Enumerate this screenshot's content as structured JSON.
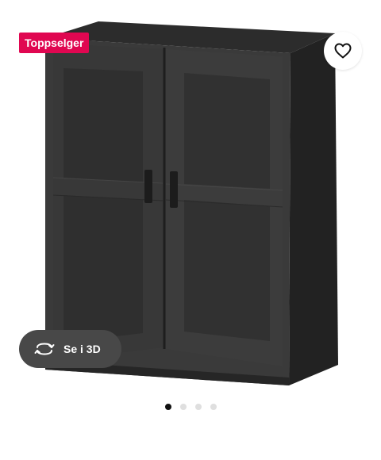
{
  "badge": {
    "label": "Toppselger"
  },
  "favorite": {
    "icon": "heart-outline-icon"
  },
  "view_3d": {
    "label": "Se i 3D",
    "icon": "rotate-3d-icon"
  },
  "carousel": {
    "total": 4,
    "active_index": 0
  },
  "colors": {
    "badge_bg": "#e00751",
    "pill_bg": "#484848",
    "cabinet": "#3a3a3a",
    "dot_active": "#111111",
    "dot_inactive": "#dfdfdf"
  }
}
